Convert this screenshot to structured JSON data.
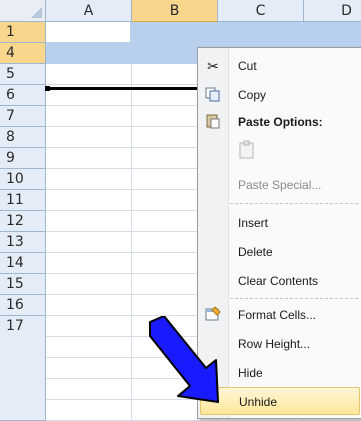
{
  "columns": [
    "A",
    "B",
    "C",
    "D"
  ],
  "rows": [
    "1",
    "4",
    "5",
    "6",
    "7",
    "8",
    "9",
    "10",
    "11",
    "12",
    "13",
    "14",
    "15",
    "16",
    "17"
  ],
  "selected_rows": [
    "1",
    "4"
  ],
  "context_menu": {
    "items": [
      {
        "label": "Cut",
        "icon": "scissors-icon"
      },
      {
        "label": "Copy",
        "icon": "copy-icon"
      },
      {
        "label": "Paste Options:",
        "icon": "clipboard-icon"
      },
      {
        "label": "Paste Special...",
        "icon": ""
      },
      {
        "label": "Insert",
        "icon": ""
      },
      {
        "label": "Delete",
        "icon": ""
      },
      {
        "label": "Clear Contents",
        "icon": ""
      },
      {
        "label": "Format Cells...",
        "icon": "format-cells-icon"
      },
      {
        "label": "Row Height...",
        "icon": ""
      },
      {
        "label": "Hide",
        "icon": ""
      },
      {
        "label": "Unhide",
        "icon": ""
      }
    ],
    "highlighted": "Unhide"
  },
  "colors": {
    "header_bg": "#e4ecf7",
    "header_selected": "#f8d68c",
    "selection": "#b8cfee",
    "arrow": "#1a1aff",
    "menu_highlight": "#ffe79b"
  }
}
